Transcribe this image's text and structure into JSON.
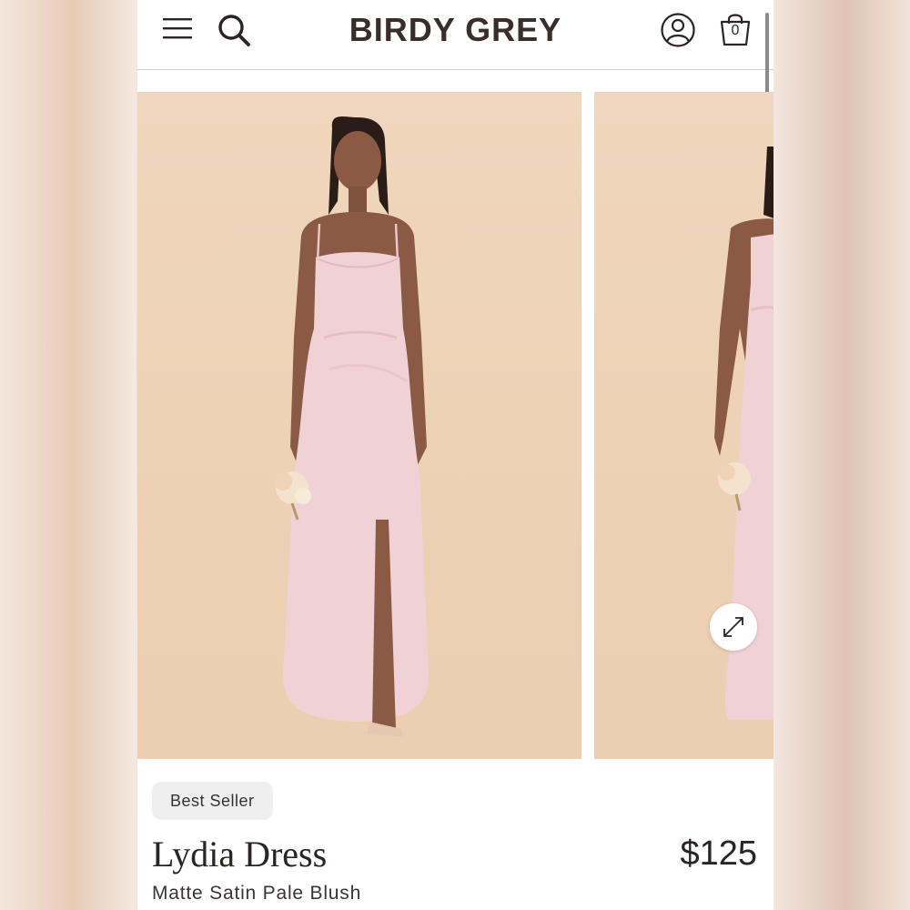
{
  "header": {
    "brand": "BIRDY GREY",
    "menu_icon": "hamburger-icon",
    "search_icon": "search-icon",
    "account_icon": "account-icon",
    "bag_icon": "shopping-bag-icon",
    "bag_count": "0"
  },
  "gallery": {
    "images": [
      {
        "name": "product-photo-front"
      },
      {
        "name": "product-photo-side"
      }
    ],
    "expand_icon": "expand-arrows-icon"
  },
  "product": {
    "badge": "Best Seller",
    "name": "Lydia Dress",
    "price": "$125",
    "variant": "Matte Satin Pale Blush"
  },
  "colors": {
    "brand_text": "#3a2e2c",
    "photo_background": "#efd6bc",
    "dress": "#f0d2d6",
    "badge_bg": "#efefef"
  }
}
